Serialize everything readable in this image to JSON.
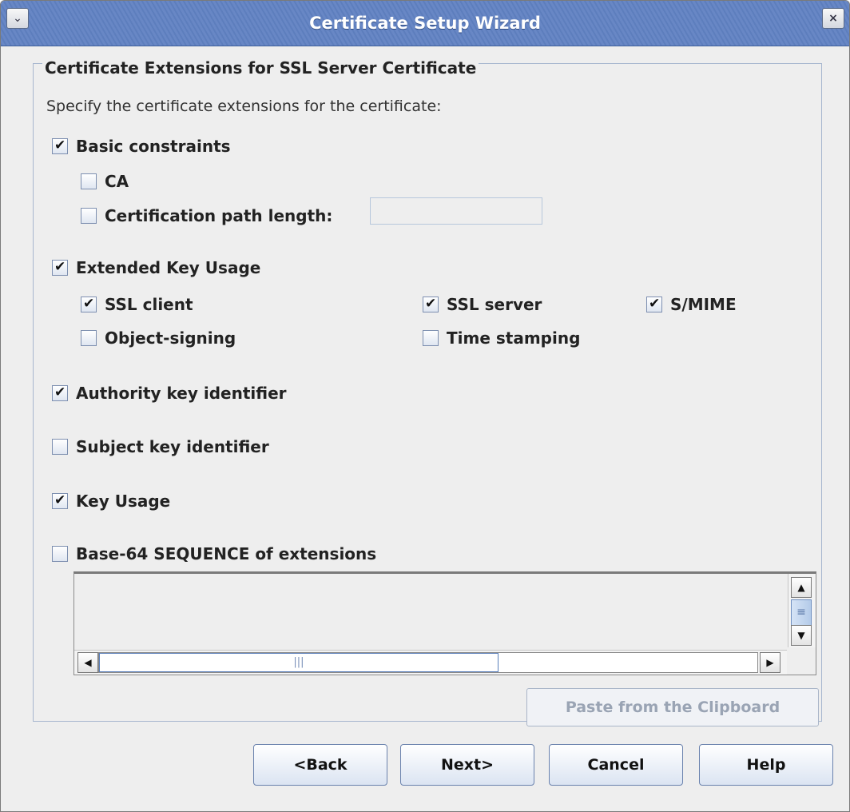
{
  "window": {
    "title": "Certificate Setup Wizard",
    "menu_icon": "chevron-down-icon",
    "close_icon": "close-icon"
  },
  "group": {
    "title": "Certificate Extensions for SSL Server Certificate",
    "instruction": "Specify the certificate extensions for the certificate:"
  },
  "options": {
    "basic_constraints": {
      "label": "Basic constraints",
      "checked": true
    },
    "ca": {
      "label": "CA",
      "checked": false
    },
    "path_length": {
      "label": "Certification path length:",
      "checked": false,
      "value": ""
    },
    "extended_key_usage": {
      "label": "Extended Key Usage",
      "checked": true
    },
    "ssl_client": {
      "label": "SSL client",
      "checked": true
    },
    "ssl_server": {
      "label": "SSL server",
      "checked": true
    },
    "smime": {
      "label": "S/MIME",
      "checked": true
    },
    "object_signing": {
      "label": "Object-signing",
      "checked": false
    },
    "time_stamping": {
      "label": "Time stamping",
      "checked": false
    },
    "authority_key_identifier": {
      "label": "Authority key identifier",
      "checked": true
    },
    "subject_key_identifier": {
      "label": "Subject key identifier",
      "checked": false
    },
    "key_usage": {
      "label": "Key Usage",
      "checked": true
    },
    "base64_sequence": {
      "label": "Base-64 SEQUENCE of extensions",
      "checked": false,
      "value": ""
    }
  },
  "paste_button": {
    "label": "Paste from the Clipboard",
    "enabled": false
  },
  "buttons": {
    "back": "<Back",
    "next": "Next>",
    "cancel": "Cancel",
    "help": "Help"
  },
  "colors": {
    "titlebar": "#5d7ebd",
    "background": "#eeeeee",
    "border_accent": "#a7b6cf"
  }
}
